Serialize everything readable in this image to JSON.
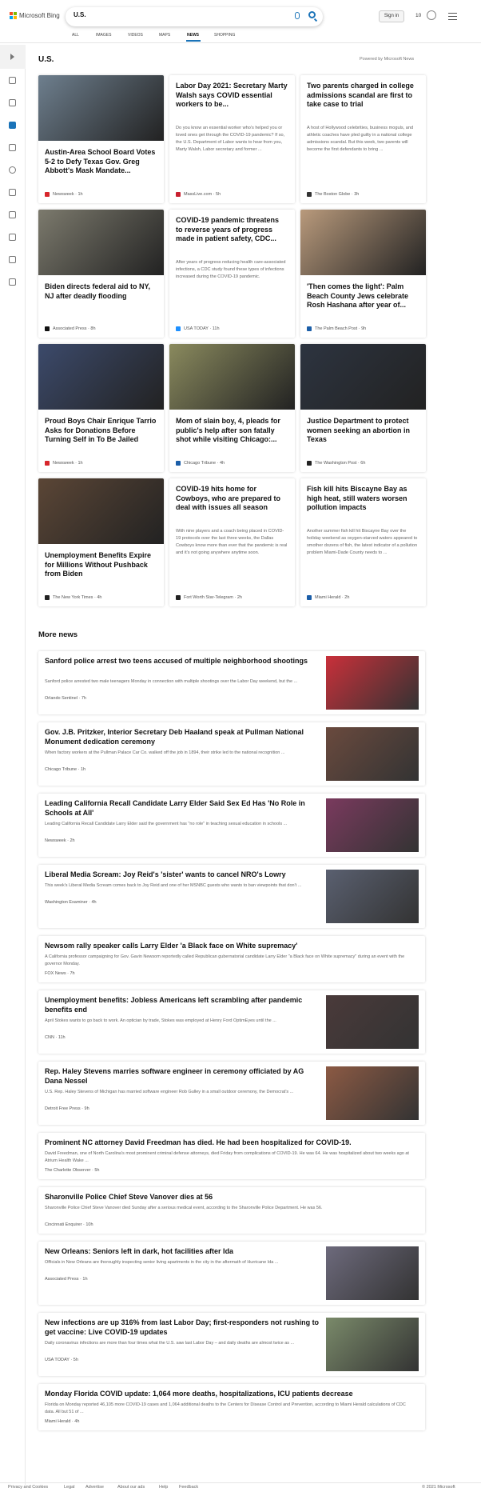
{
  "header": {
    "brand": "Microsoft Bing",
    "query": "U.S.",
    "signin": "Sign in",
    "rewards": "10"
  },
  "nav": {
    "tabs": [
      "ALL",
      "IMAGES",
      "VIDEOS",
      "MAPS",
      "NEWS",
      "SHOPPING"
    ],
    "active": "NEWS"
  },
  "section": {
    "title": "U.S.",
    "powered": "Powered by Microsoft News"
  },
  "cards": [
    {
      "title": "Austin-Area School Board Votes 5-2 to Defy Texas Gov. Greg Abbott's Mask Mandate...",
      "snippet": "",
      "source": "Newsweek",
      "age": "1h",
      "fav": "#d7262b",
      "img": "#6e7f8e"
    },
    {
      "title": "Labor Day 2021: Secretary Marty Walsh says COVID essential workers to be...",
      "snippet": "Do you know an essential worker who's helped you or loved ones get through the COVID-19 pandemic? If so, the U.S. Department of Labor wants to hear from you, Marty Walsh, Labor secretary and former ...",
      "source": "MassLive.com",
      "age": "5h",
      "fav": "#c8202f",
      "img": ""
    },
    {
      "title": "Two parents charged in college admissions scandal are first to take case to trial",
      "snippet": "A host of Hollywood celebrities, business moguls, and athletic coaches have pled guilty in a national college admissions scandal. But this week, two parents will become the first defendants to bring ...",
      "source": "The Boston Globe",
      "age": "3h",
      "fav": "#333333",
      "img": ""
    },
    {
      "title": "Biden directs federal aid to NY, NJ after deadly flooding",
      "snippet": "",
      "source": "Associated Press",
      "age": "8h",
      "fav": "#111111",
      "img": "#7c7a6d"
    },
    {
      "title": "COVID-19 pandemic threatens to reverse years of progress made in patient safety, CDC...",
      "snippet": "After years of progress reducing health care-associated infections, a CDC study found these types of infections increased during the COVID-19 pandemic.",
      "source": "USA TODAY",
      "age": "11h",
      "fav": "#1e90ff",
      "img": ""
    },
    {
      "title": "'Then comes the light': Palm Beach County Jews celebrate Rosh Hashana after year of...",
      "snippet": "",
      "source": "The Palm Beach Post",
      "age": "9h",
      "fav": "#1b5ea8",
      "img": "#b99a7c"
    },
    {
      "title": "Proud Boys Chair Enrique Tarrio Asks for Donations Before Turning Self in To Be Jailed",
      "snippet": "",
      "source": "Newsweek",
      "age": "1h",
      "fav": "#d7262b",
      "img": "#3c4a6b"
    },
    {
      "title": "Mom of slain boy, 4, pleads for public's help after son fatally shot while visiting Chicago:...",
      "snippet": "",
      "source": "Chicago Tribune",
      "age": "4h",
      "fav": "#1b5ea8",
      "img": "#8a8a5e"
    },
    {
      "title": "Justice Department to protect women seeking an abortion in Texas",
      "snippet": "",
      "source": "The Washington Post",
      "age": "6h",
      "fav": "#222222",
      "img": "#2d3440"
    },
    {
      "title": "Unemployment Benefits Expire for Millions Without Pushback from Biden",
      "snippet": "",
      "source": "The New York Times",
      "age": "4h",
      "fav": "#222222",
      "img": "#5b4636"
    },
    {
      "title": "COVID-19 hits home for Cowboys, who are prepared to deal with issues all season",
      "snippet": "With nine players and a coach being placed in COVID-19 protocols over the last three weeks, the Dallas Cowboys know more than ever that the pandemic is real and it's not going anywhere anytime soon.",
      "source": "Fort Worth Star-Telegram",
      "age": "2h",
      "fav": "#222222",
      "img": ""
    },
    {
      "title": "Fish kill hits Biscayne Bay as high heat, still waters worsen pollution impacts",
      "snippet": "Another summer fish kill hit Biscayne Bay over the holiday weekend as oxygen-starved waters appeared to smother dozens of fish, the latest indicator of a pollution problem Miami-Dade County needs to ...",
      "source": "Miami Herald",
      "age": "2h",
      "fav": "#1b5ea8",
      "img": ""
    }
  ],
  "more": {
    "title": "More news",
    "items": [
      {
        "title": "Sanford police arrest two teens accused of multiple neighborhood shootings",
        "snippet": "Sanford police arrested two male teenagers Monday in connection with multiple shootings over the Labor Day weekend, but the ...",
        "source": "Orlando Sentinel",
        "age": "7h",
        "fav": "#111111",
        "img": "#c9303a"
      },
      {
        "title": "Gov. J.B. Pritzker, Interior Secretary Deb Haaland speak at Pullman National Monument dedication ceremony",
        "snippet": "When factory workers at the Pullman Palace Car Co. walked off the job in 1894, their strike led to the national recognition ...",
        "source": "Chicago Tribune",
        "age": "1h",
        "fav": "#1b5ea8",
        "img": "#6a4a3e"
      },
      {
        "title": "Leading California Recall Candidate Larry Elder Said Sex Ed Has 'No Role in Schools at All'",
        "snippet": "Leading California Recall Candidate Larry Elder said the government has \"no role\" in teaching sexual education in schools ...",
        "source": "Newsweek",
        "age": "2h",
        "fav": "#d7262b",
        "img": "#7a3a5e"
      },
      {
        "title": "Liberal Media Scream: Joy Reid's 'sister' wants to cancel NRO's Lowry",
        "snippet": "This week's Liberal Media Scream comes back to Joy Reid and one of her MSNBC guests who wants to ban viewpoints that don't ...",
        "source": "Washington Examiner",
        "age": "4h",
        "fav": "#222222",
        "img": "#5a6070"
      },
      {
        "title": "Newsom rally speaker calls Larry Elder 'a Black face on White supremacy'",
        "snippet": "A California professor campaigning for Gov. Gavin Newsom reportedly called Republican gubernatorial candidate Larry Elder \"a Black face on White supremacy\" during an event with the governor Monday.",
        "source": "FOX News",
        "age": "7h",
        "fav": "#1b3f8a",
        "img": ""
      },
      {
        "title": "Unemployment benefits: Jobless Americans left scrambling after pandemic benefits end",
        "snippet": "April Stokes wants to go back to work. An optician by trade, Stokes was employed at Henry Ford OptimEyes until the ...",
        "source": "CNN",
        "age": "11h",
        "fav": "#cc0000",
        "img": "#4a3a3a"
      },
      {
        "title": "Rep. Haley Stevens marries software engineer in ceremony officiated by AG Dana Nessel",
        "snippet": "U.S. Rep. Haley Stevens of Michigan has married software engineer Rob Gulley in a small outdoor ceremony, the Democrat's ...",
        "source": "Detroit Free Press",
        "age": "9h",
        "fav": "#1b5ea8",
        "img": "#8c5a44"
      },
      {
        "title": "Prominent NC attorney David Freedman has died. He had been hospitalized for COVID-19.",
        "snippet": "David Freedman, one of North Carolina's most prominent criminal defense attorneys, died Friday from complications of COVID-19. He was 64. He was hospitalized about two weeks ago at Atrium Health Wake ...",
        "source": "The Charlotte Observer",
        "age": "5h",
        "fav": "#1b5ea8",
        "img": ""
      },
      {
        "title": "Sharonville Police Chief Steve Vanover dies at 56",
        "snippet": "Sharonville Police Chief Steve Vanover died Sunday after a serious medical event, according to the Sharonville Police Department. He was 56.",
        "source": "Cincinnati Enquirer",
        "age": "10h",
        "fav": "#1b5ea8",
        "img": ""
      },
      {
        "title": "New Orleans: Seniors left in dark, hot facilities after Ida",
        "snippet": "Officials in New Orleans are thoroughly inspecting senior living apartments in the city in the aftermath of Hurricane Ida ...",
        "source": "Associated Press",
        "age": "1h",
        "fav": "#111111",
        "img": "#6d6a7c"
      },
      {
        "title": "New infections are up 316% from last Labor Day; first-responders not rushing to get vaccine: Live COVID-19 updates",
        "snippet": "Daily coronavirus infections are more than four times what the U.S. saw last Labor Day – and daily deaths are almost twice as ...",
        "source": "USA TODAY",
        "age": "5h",
        "fav": "#1e90ff",
        "img": "#7a8a6a"
      },
      {
        "title": "Monday Florida COVID update: 1,064 more deaths, hospitalizations, ICU patients decrease",
        "snippet": "Florida on Monday reported 46,105 more COVID-19 cases and 1,064 additional deaths to the Centers for Disease Control and Prevention, according to Miami Herald calculations of CDC data. All but 51 of ...",
        "source": "Miami Herald",
        "age": "4h",
        "fav": "#1b5ea8",
        "img": ""
      }
    ]
  },
  "footer": {
    "links": [
      "Privacy and Cookies",
      "Legal",
      "Advertise",
      "About our ads",
      "Help",
      "Feedback"
    ],
    "copyright": "© 2021 Microsoft"
  }
}
